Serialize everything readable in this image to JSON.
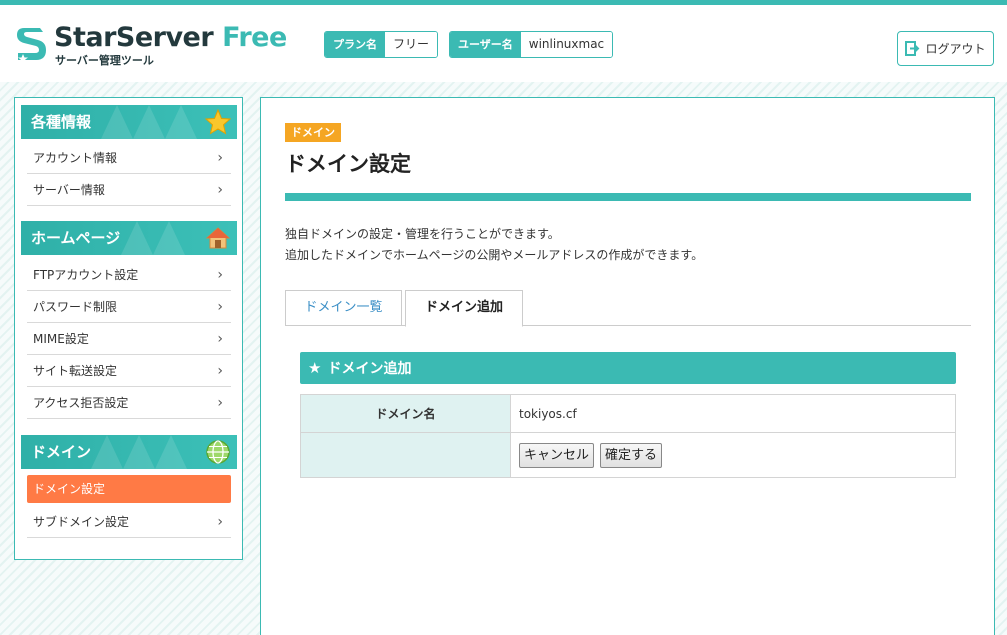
{
  "header": {
    "logo_title": "StarServer",
    "logo_title_accent": "Free",
    "logo_subtitle": "サーバー管理ツール",
    "plan_label": "プラン名",
    "plan_value": "フリー",
    "user_label": "ユーザー名",
    "user_value": "winlinuxmac",
    "logout_label": "ログアウト"
  },
  "sidebar": {
    "sections": [
      {
        "title": "各種情報",
        "icon": "star-icon",
        "items": [
          "アカウント情報",
          "サーバー情報"
        ]
      },
      {
        "title": "ホームページ",
        "icon": "house-icon",
        "items": [
          "FTPアカウント設定",
          "パスワード制限",
          "MIME設定",
          "サイト転送設定",
          "アクセス拒否設定"
        ]
      },
      {
        "title": "ドメイン",
        "icon": "globe-icon",
        "items": [
          "ドメイン設定",
          "サブドメイン設定"
        ],
        "active": "ドメイン設定"
      }
    ]
  },
  "main": {
    "category_badge": "ドメイン",
    "page_title": "ドメイン設定",
    "description_line1": "独自ドメインの設定・管理を行うことができます。",
    "description_line2": "追加したドメインでホームページの公開やメールアドレスの作成ができます。",
    "tabs": [
      "ドメイン一覧",
      "ドメイン追加"
    ],
    "active_tab": "ドメイン追加",
    "section_title": "ドメイン追加",
    "form": {
      "domain_label": "ドメイン名",
      "domain_value": "tokiyos.cf",
      "cancel_label": "キャンセル",
      "confirm_label": "確定する"
    }
  },
  "colors": {
    "accent": "#3bbab3",
    "active_item": "#ff7a45",
    "badge": "#f5a623"
  }
}
